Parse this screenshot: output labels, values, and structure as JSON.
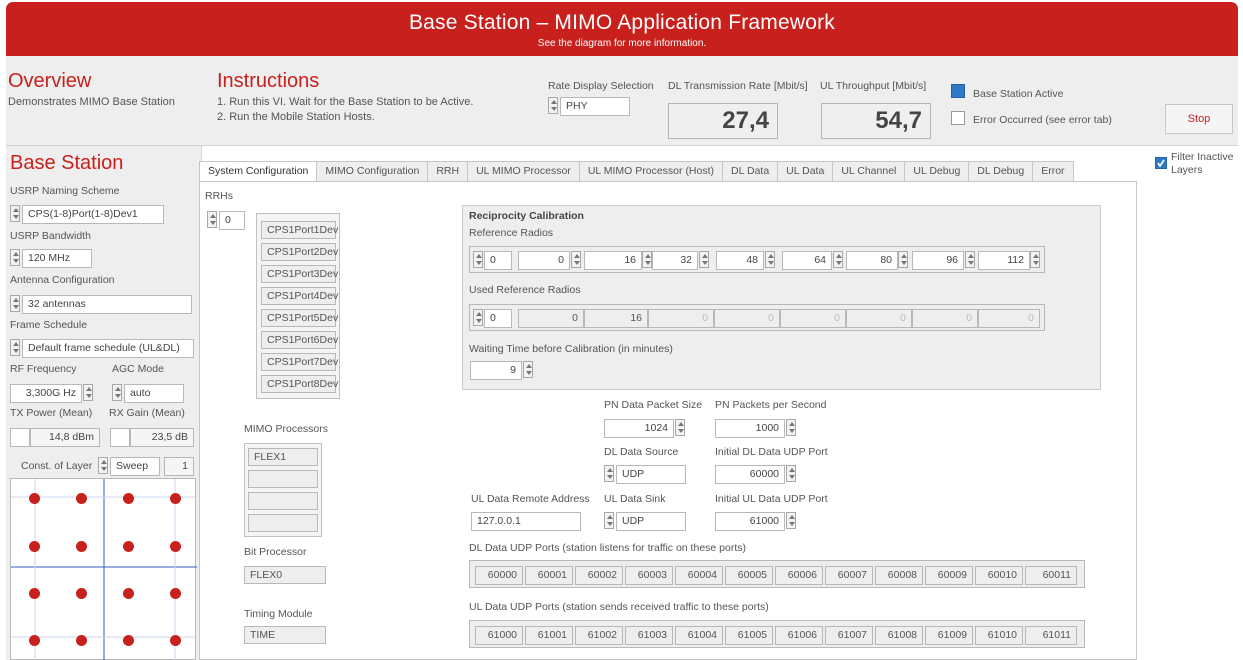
{
  "header": {
    "title": "Base Station – MIMO Application Framework",
    "subtitle": "See the diagram for more information."
  },
  "overview": {
    "title": "Overview",
    "text": "Demonstrates MIMO Base Station"
  },
  "instructions": {
    "title": "Instructions",
    "lines": [
      "1. Run this VI. Wait for the Base Station to be Active.",
      "2. Run the Mobile Station Hosts."
    ]
  },
  "rate_display": {
    "label": "Rate Display Selection",
    "value": "PHY"
  },
  "dl_rate": {
    "label": "DL Transmission Rate [Mbit/s]",
    "value": "27,4"
  },
  "ul_throughput": {
    "label": "UL Throughput [Mbit/s]",
    "value": "54,7"
  },
  "status": {
    "active_label": "Base Station Active",
    "error_label": "Error Occurred (see error tab)"
  },
  "stop_label": "Stop",
  "filter": {
    "line1": "Filter Inactive",
    "line2": "Layers",
    "checked": true
  },
  "base_station": {
    "title": "Base Station",
    "naming_label": "USRP Naming Scheme",
    "naming_value": "CPS(1-8)Port(1-8)Dev1",
    "bandwidth_label": "USRP Bandwidth",
    "bandwidth_value": "120 MHz",
    "antenna_label": "Antenna Configuration",
    "antenna_value": "32 antennas",
    "frame_label": "Frame Schedule",
    "frame_value": "Default frame schedule (UL&DL)",
    "rf_label": "RF Frequency",
    "rf_value": "3,300G Hz",
    "agc_label": "AGC Mode",
    "agc_value": "auto",
    "tx_label": "TX Power (Mean)",
    "tx_value": "14,8 dBm",
    "rx_label": "RX Gain (Mean)",
    "rx_value": "23,5 dB",
    "const_label": "Const. of Layer",
    "const_mode": "Sweep",
    "const_value": "1",
    "constellation_color": "#c8211d"
  },
  "tabs": [
    "System Configuration",
    "MIMO Configuration",
    "RRH",
    "UL MIMO Processor",
    "UL MIMO Processor (Host)",
    "DL Data",
    "UL Data",
    "UL Channel",
    "UL Debug",
    "DL Debug",
    "Error"
  ],
  "rrhs": {
    "label": "RRHs",
    "index": "0",
    "devices": [
      "CPS1Port1Dev",
      "CPS1Port2Dev",
      "CPS1Port3Dev",
      "CPS1Port4Dev",
      "CPS1Port5Dev",
      "CPS1Port6Dev",
      "CPS1Port7Dev",
      "CPS1Port8Dev"
    ]
  },
  "mimo_processors": {
    "label": "MIMO Processors",
    "items": [
      "FLEX1",
      "",
      "",
      ""
    ]
  },
  "bit_processor": {
    "label": "Bit Processor",
    "value": "FLEX0"
  },
  "timing_module": {
    "label": "Timing Module",
    "value": "TIME"
  },
  "reciprocity": {
    "title": "Reciprocity Calibration",
    "ref_label": "Reference Radios",
    "ref_index": "0",
    "ref_values": [
      "0",
      "16",
      "32",
      "48",
      "64",
      "80",
      "96",
      "112"
    ],
    "used_label": "Used Reference Radios",
    "used_index": "0",
    "used_values": [
      "0",
      "16",
      "0",
      "0",
      "0",
      "0",
      "0",
      "0"
    ],
    "wait_label": "Waiting Time before Calibration (in minutes)",
    "wait_value": "9"
  },
  "pn": {
    "size_label": "PN Data Packet Size",
    "size_value": "1024",
    "rate_label": "PN Packets per Second",
    "rate_value": "1000"
  },
  "dl_source": {
    "label": "DL Data Source",
    "value": "UDP"
  },
  "dl_port": {
    "label": "Initial DL Data UDP Port",
    "value": "60000"
  },
  "ul_remote": {
    "label": "UL Data Remote Address",
    "value": "127.0.0.1"
  },
  "ul_sink": {
    "label": "UL Data Sink",
    "value": "UDP"
  },
  "ul_port": {
    "label": "Initial UL Data UDP Port",
    "value": "61000"
  },
  "dl_ports": {
    "label": "DL Data UDP Ports (station listens for traffic on these ports)",
    "values": [
      "60000",
      "60001",
      "60002",
      "60003",
      "60004",
      "60005",
      "60006",
      "60007",
      "60008",
      "60009",
      "60010",
      "60011"
    ]
  },
  "ul_ports": {
    "label": "UL Data UDP Ports (station sends received traffic to these ports)",
    "values": [
      "61000",
      "61001",
      "61002",
      "61003",
      "61004",
      "61005",
      "61006",
      "61007",
      "61008",
      "61009",
      "61010",
      "61011"
    ]
  }
}
